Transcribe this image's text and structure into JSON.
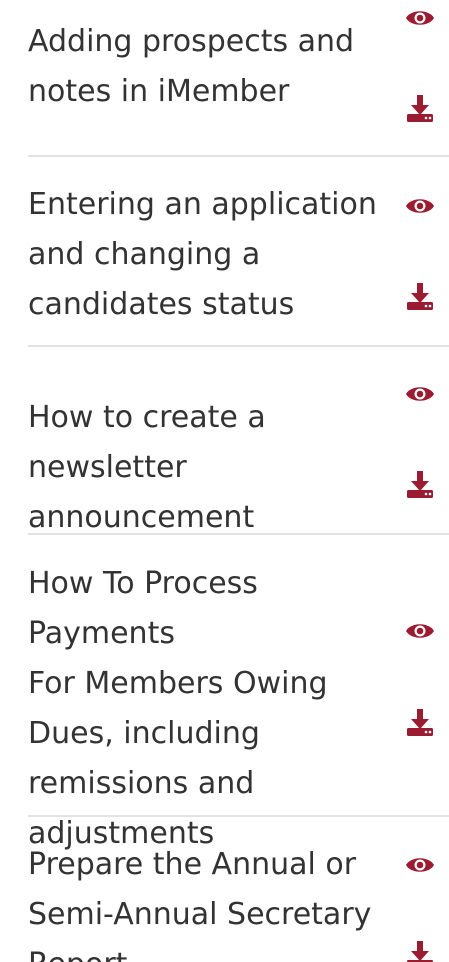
{
  "accent_color": "#9b1b30",
  "items": [
    {
      "title": "Adding prospects and\nnotes in iMember",
      "view_icon": "eye-icon",
      "download_icon": "download-icon"
    },
    {
      "title": "Entering an application\nand changing a\ncandidates status",
      "view_icon": "eye-icon",
      "download_icon": "download-icon"
    },
    {
      "title": "How to create a\nnewsletter announcement",
      "view_icon": "eye-icon",
      "download_icon": "download-icon"
    },
    {
      "title": "How To Process Payments\nFor Members Owing\nDues, including\nremissions and\nadjustments",
      "view_icon": "eye-icon",
      "download_icon": "download-icon"
    },
    {
      "title": "Prepare the Annual or\nSemi-Annual Secretary\nReport",
      "view_icon": "eye-icon",
      "download_icon": "download-icon"
    }
  ]
}
